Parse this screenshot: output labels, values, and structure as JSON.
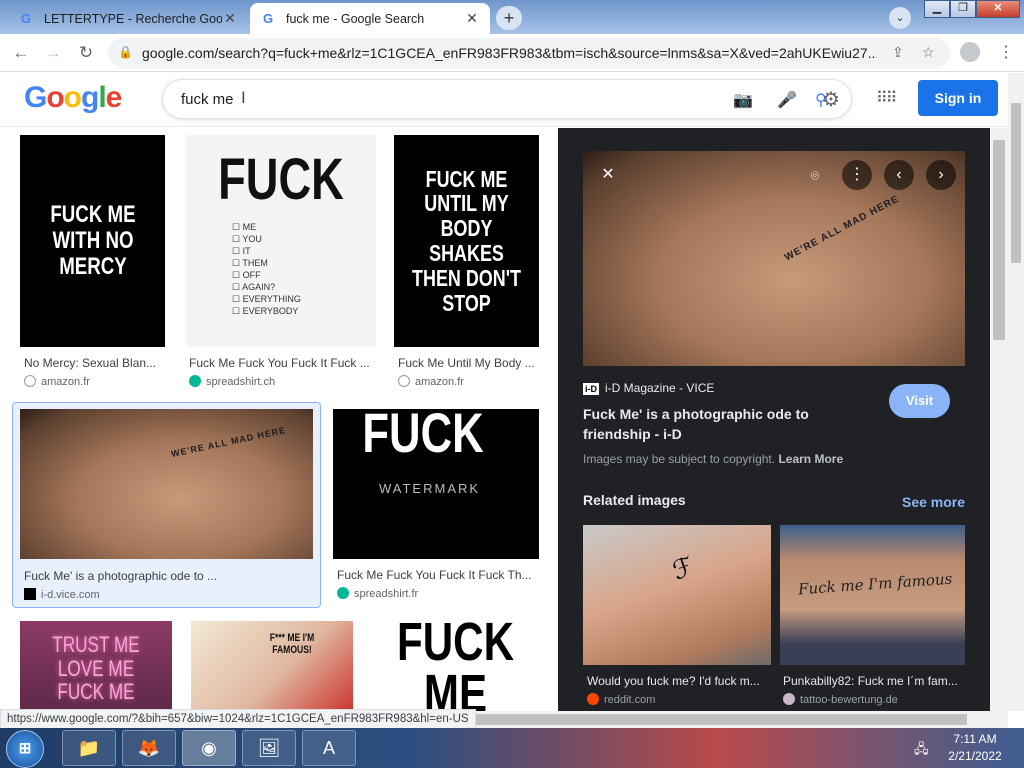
{
  "browser": {
    "tabs": [
      {
        "title": "LETTERTYPE - Recherche Google",
        "active": false
      },
      {
        "title": "fuck me - Google Search",
        "active": true
      }
    ],
    "url": "google.com/search?q=fuck+me&rlz=1C1GCEA_enFR983FR983&tbm=isch&source=lnms&sa=X&ved=2ahUKEwiu27...",
    "status_url": "https://www.google.com/?&bih=657&biw=1024&rlz=1C1GCEA_enFR983FR983&hl=en-US"
  },
  "header": {
    "logo": "Google",
    "query": "fuck me",
    "signin_label": "Sign in"
  },
  "results": [
    {
      "poster": "FUCK ME WITH NO MERCY",
      "title": "No Mercy: Sexual Blan...",
      "source": "amazon.fr",
      "source_icon": "amazon-icon"
    },
    {
      "poster": "FUCK",
      "checklist": [
        "ME",
        "YOU",
        "IT",
        "THEM",
        "OFF",
        "AGAIN?",
        "EVERYTHING",
        "EVERYBODY"
      ],
      "title": "Fuck Me Fuck You Fuck It Fuck ...",
      "source": "spreadshirt.ch",
      "source_icon": "spreadshirt-icon"
    },
    {
      "poster": "FUCK ME UNTIL MY BODY SHAKES THEN DON'T STOP",
      "title": "Fuck Me Until My Body ...",
      "source": "amazon.fr",
      "source_icon": "amazon-icon"
    },
    {
      "title": "Fuck Me' is a photographic ode to ...",
      "source": "i-d.vice.com",
      "source_icon": "id-icon",
      "tattoo": "WE'RE ALL MAD HERE"
    },
    {
      "poster": "FUCK",
      "watermark": "WATERMARK",
      "title": "Fuck Me Fuck You Fuck It Fuck Th...",
      "source": "spreadshirt.fr",
      "source_icon": "spreadshirt-icon"
    },
    {
      "poster": "TRUST ME LOVE ME FUCK ME"
    },
    {
      "poster": "F*** ME I'M FAMOUS!"
    },
    {
      "poster": "FUCK ME"
    }
  ],
  "panel": {
    "source_logo": "i-D",
    "source_name": "i-D Magazine - VICE",
    "title": "Fuck Me' is a photographic ode to friendship - i-D",
    "visit_label": "Visit",
    "copyright": "Images may be subject to copyright.",
    "learn_more": "Learn More",
    "related_heading": "Related images",
    "see_more": "See more",
    "image_tattoo": "WE'RE ALL MAD HERE",
    "related": [
      {
        "title": "Would you fuck me? I'd fuck m...",
        "source": "reddit.com"
      },
      {
        "title": "Punkabilly82: Fuck me I´m fam...",
        "source": "tattoo-bewertung.de",
        "tattoo": "Fuck me I'm famous"
      }
    ]
  },
  "taskbar": {
    "time": "7:11 AM",
    "date": "2/21/2022"
  },
  "colors": {
    "accent": "#1a73e8",
    "panel_bg": "#202124",
    "link": "#8ab4f8"
  }
}
